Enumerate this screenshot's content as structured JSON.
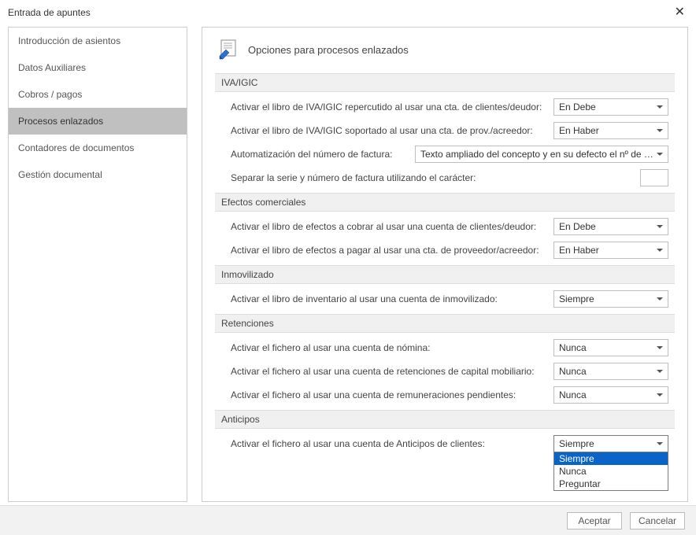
{
  "window": {
    "title": "Entrada de apuntes"
  },
  "sidebar": {
    "items": [
      {
        "label": "Introducción de asientos",
        "selected": false
      },
      {
        "label": "Datos Auxiliares",
        "selected": false
      },
      {
        "label": "Cobros / pagos",
        "selected": false
      },
      {
        "label": "Procesos enlazados",
        "selected": true
      },
      {
        "label": "Contadores de documentos",
        "selected": false
      },
      {
        "label": "Gestión documental",
        "selected": false
      }
    ]
  },
  "main": {
    "title": "Opciones para procesos enlazados",
    "sections": {
      "iva": {
        "header": "IVA/IGIC",
        "repercutido_label": "Activar el libro de IVA/IGIC repercutido al usar una cta. de clientes/deudor:",
        "repercutido_value": "En Debe",
        "soportado_label": "Activar el libro de IVA/IGIC soportado al usar una cta. de prov./acreedor:",
        "soportado_value": "En Haber",
        "autofactura_label": "Automatización del número de factura:",
        "autofactura_value": "Texto ampliado del concepto y en su defecto el nº de docu",
        "separador_label": "Separar la serie y número de factura utilizando el carácter:",
        "separador_value": ""
      },
      "efectos": {
        "header": "Efectos comerciales",
        "cobrar_label": "Activar el libro de efectos a cobrar al usar una cuenta de clientes/deudor:",
        "cobrar_value": "En Debe",
        "pagar_label": "Activar el libro de efectos a pagar al usar una cta. de proveedor/acreedor:",
        "pagar_value": "En Haber"
      },
      "inmovilizado": {
        "header": "Inmovilizado",
        "inventario_label": "Activar el libro de inventario al usar una cuenta de inmovilizado:",
        "inventario_value": "Siempre"
      },
      "retenciones": {
        "header": "Retenciones",
        "nomina_label": "Activar el fichero al usar una cuenta de nómina:",
        "nomina_value": "Nunca",
        "capital_label": "Activar el fichero al usar una cuenta de retenciones de capital mobiliario:",
        "capital_value": "Nunca",
        "remun_label": "Activar el fichero al usar una cuenta de remuneraciones pendientes:",
        "remun_value": "Nunca"
      },
      "anticipos": {
        "header": "Anticipos",
        "clientes_label": "Activar el fichero al usar una cuenta de Anticipos de clientes:",
        "clientes_value": "Siempre",
        "options": [
          "Siempre",
          "Nunca",
          "Preguntar"
        ]
      }
    }
  },
  "footer": {
    "accept": "Aceptar",
    "cancel": "Cancelar"
  }
}
